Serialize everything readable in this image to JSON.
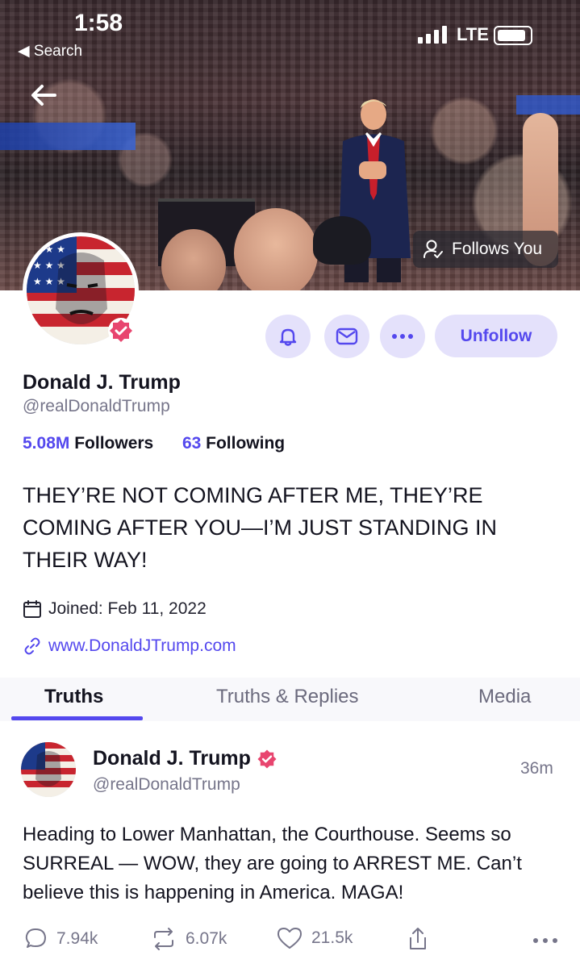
{
  "status_bar": {
    "time": "1:58",
    "back_app": "◀ Search",
    "network": "LTE"
  },
  "banner": {
    "follows_you": "Follows You"
  },
  "actions": {
    "bell_icon": "bell-icon",
    "mail_icon": "mail-icon",
    "more_icon": "more-horizontal-icon",
    "unfollow_label": "Unfollow"
  },
  "profile": {
    "name": "Donald J. Trump",
    "handle": "@realDonaldTrump",
    "followers_count": "5.08M",
    "followers_label": "Followers",
    "following_count": "63",
    "following_label": "Following",
    "bio": "THEY’RE NOT COMING AFTER ME, THEY’RE COMING AFTER YOU—I’M JUST STANDING IN THEIR WAY!",
    "joined": "Joined: Feb 11, 2022",
    "website": "www.DonaldJTrump.com"
  },
  "tabs": [
    {
      "label": "Truths",
      "active": true
    },
    {
      "label": "Truths & Replies",
      "active": false
    },
    {
      "label": "Media",
      "active": false
    }
  ],
  "post": {
    "author": "Donald J. Trump",
    "handle": "@realDonaldTrump",
    "time": "36m",
    "text": "Heading to Lower Manhattan, the Courthouse. Seems so SURREAL — WOW, they are going to ARREST ME. Can’t believe this is happening in America. MAGA!",
    "replies": "7.94k",
    "retruths": "6.07k",
    "likes": "21.5k"
  },
  "colors": {
    "accent": "#5448ee",
    "accent_bg": "#e4e1fb",
    "verified": "#e8456f",
    "muted_text": "#76758a"
  }
}
